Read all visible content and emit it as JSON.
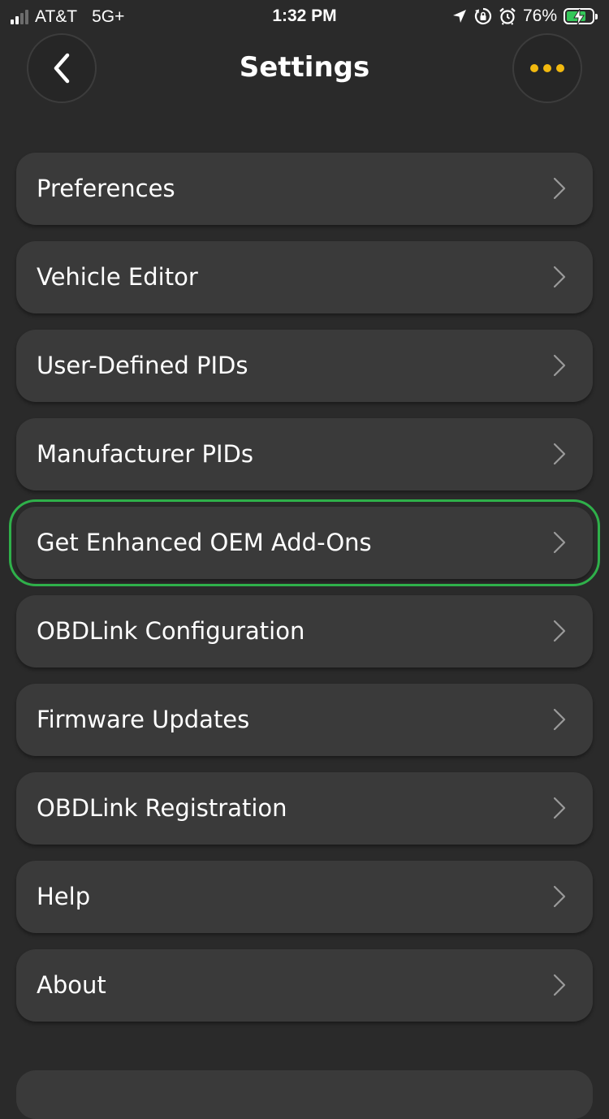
{
  "status_bar": {
    "carrier": "AT&T",
    "network": "5G+",
    "time": "1:32 PM",
    "battery_percent": "76%",
    "battery_level": 0.76,
    "battery_color": "#34c759",
    "icons": [
      "signal-icon",
      "location-arrow-icon",
      "orientation-lock-icon",
      "alarm-icon",
      "battery-charging-icon"
    ]
  },
  "header": {
    "title": "Settings",
    "back_icon": "chevron-left-icon",
    "more_icon": "ellipsis-icon",
    "accent_color": "#f2b90f"
  },
  "menu": {
    "highlight_color": "#2fb04a",
    "items": [
      {
        "label": "Preferences"
      },
      {
        "label": "Vehicle Editor"
      },
      {
        "label": "User-Defined PIDs"
      },
      {
        "label": "Manufacturer PIDs"
      },
      {
        "label": "Get Enhanced OEM Add-Ons",
        "highlighted": true
      },
      {
        "label": "OBDLink Configuration"
      },
      {
        "label": "Firmware Updates"
      },
      {
        "label": "OBDLink Registration"
      },
      {
        "label": "Help"
      },
      {
        "label": "About"
      }
    ]
  }
}
